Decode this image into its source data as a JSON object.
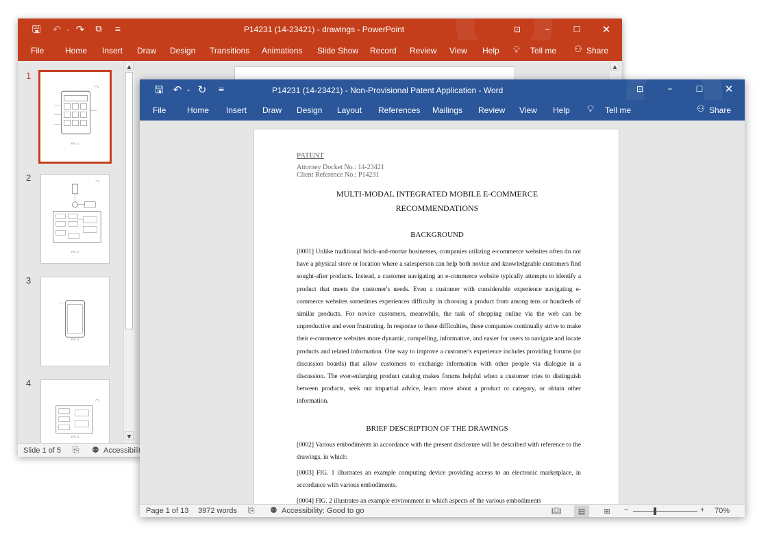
{
  "powerpoint": {
    "title": "P14231 (14-23421) - drawings  -  PowerPoint",
    "qat": {
      "save_icon": "save-icon",
      "undo_icon": "undo-icon",
      "redo_icon": "redo-icon",
      "present_icon": "start-slideshow-icon",
      "customize_icon": "customize-qat-icon"
    },
    "tabs": [
      "File",
      "Home",
      "Insert",
      "Draw",
      "Design",
      "Transitions",
      "Animations",
      "Slide Show",
      "Record",
      "Review",
      "View",
      "Help"
    ],
    "tell_me": "Tell me",
    "share": "Share",
    "slides": [
      {
        "number": "1",
        "caption": "FIG. 1"
      },
      {
        "number": "2",
        "caption": "FIG. 2"
      },
      {
        "number": "3",
        "caption": "FIG. 3"
      },
      {
        "number": "4",
        "caption": "FIG. 4"
      }
    ],
    "status": {
      "slide_info": "Slide 1 of 5",
      "accessibility": "Accessibilit"
    },
    "colors": {
      "accent": "#c43e1c"
    }
  },
  "word": {
    "title": "P14231 (14-23421) - Non-Provisional Patent Application  -  Word",
    "tabs": [
      "File",
      "Home",
      "Insert",
      "Draw",
      "Design",
      "Layout",
      "References",
      "Mailings",
      "Review",
      "View",
      "Help"
    ],
    "tell_me": "Tell me",
    "share": "Share",
    "document": {
      "patent_label": "PATENT",
      "docket": "Attorney Docket No.: 14-23421",
      "client_ref": "Client Reference No.: P14231",
      "title_line1": "MULTI-MODAL INTEGRATED MOBILE E-COMMERCE",
      "title_line2": "RECOMMENDATIONS",
      "heading_background": "BACKGROUND",
      "para_0001": "[0001]    Unlike traditional brick-and-mortar businesses, companies utilizing e-commerce websites often do not have a physical store or location where a salesperson can help both novice and knowledgeable customers find sought-after products. Instead, a customer navigating an e-commerce website typically attempts to identify a product that meets the customer's needs. Even a customer with considerable experience navigating e-commerce websites sometimes experiences difficulty in choosing a product from among tens or hundreds of similar products. For novice customers, meanwhile, the task of shopping online via the web can be unproductive and even frustrating. In response to these difficulties, these companies continually strive to make their e-commerce websites more dynamic, compelling, informative, and easier for users to navigate and locate products and related information. One way to improve a customer's experience includes providing forums (or discussion boards) that allow customers to exchange information with other people via dialogue in a discussion. The ever-enlarging product catalog makes forums helpful when a customer tries to distinguish between products, seek out impartial advice, learn more about a product or category, or obtain other information.",
      "heading_drawings": "BRIEF DESCRIPTION OF THE DRAWINGS",
      "para_0002": "[0002]    Various embodiments in accordance with the present disclosure will be described with reference to the drawings, in which:",
      "para_0003": "[0003]    FIG. 1 illustrates an example computing device providing access to an electronic marketplace, in accordance with various embodiments.",
      "para_0004": "[0004]    FIG. 2 illustrates an example environment in which aspects of the various embodiments"
    },
    "status": {
      "page_info": "Page 1 of 13",
      "word_count": "3972 words",
      "accessibility": "Accessibility: Good to go",
      "zoom": "70%",
      "zoom_minus": "−",
      "zoom_plus": "+"
    },
    "colors": {
      "accent": "#2b579a"
    }
  }
}
